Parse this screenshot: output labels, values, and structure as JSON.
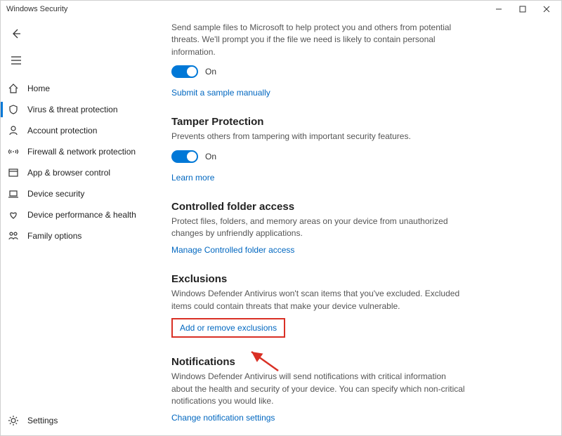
{
  "window": {
    "title": "Windows Security"
  },
  "sidebar": {
    "items": [
      {
        "label": "Home"
      },
      {
        "label": "Virus & threat protection"
      },
      {
        "label": "Account protection"
      },
      {
        "label": "Firewall & network protection"
      },
      {
        "label": "App & browser control"
      },
      {
        "label": "Device security"
      },
      {
        "label": "Device performance & health"
      },
      {
        "label": "Family options"
      }
    ],
    "settings": "Settings"
  },
  "main": {
    "sampleSubmission": {
      "desc": "Send sample files to Microsoft to help protect you and others from potential threats. We'll prompt you if the file we need is likely to contain personal information.",
      "toggleLabel": "On",
      "link": "Submit a sample manually"
    },
    "tamper": {
      "title": "Tamper Protection",
      "desc": "Prevents others from tampering with important security features.",
      "toggleLabel": "On",
      "link": "Learn more"
    },
    "cfa": {
      "title": "Controlled folder access",
      "desc": "Protect files, folders, and memory areas on your device from unauthorized changes by unfriendly applications.",
      "link": "Manage Controlled folder access"
    },
    "exclusions": {
      "title": "Exclusions",
      "desc": "Windows Defender Antivirus won't scan items that you've excluded. Excluded items could contain threats that make your device vulnerable.",
      "link": "Add or remove exclusions"
    },
    "notifications": {
      "title": "Notifications",
      "desc": "Windows Defender Antivirus will send notifications with critical information about the health and security of your device. You can specify which non-critical notifications you would like.",
      "link": "Change notification settings"
    }
  }
}
